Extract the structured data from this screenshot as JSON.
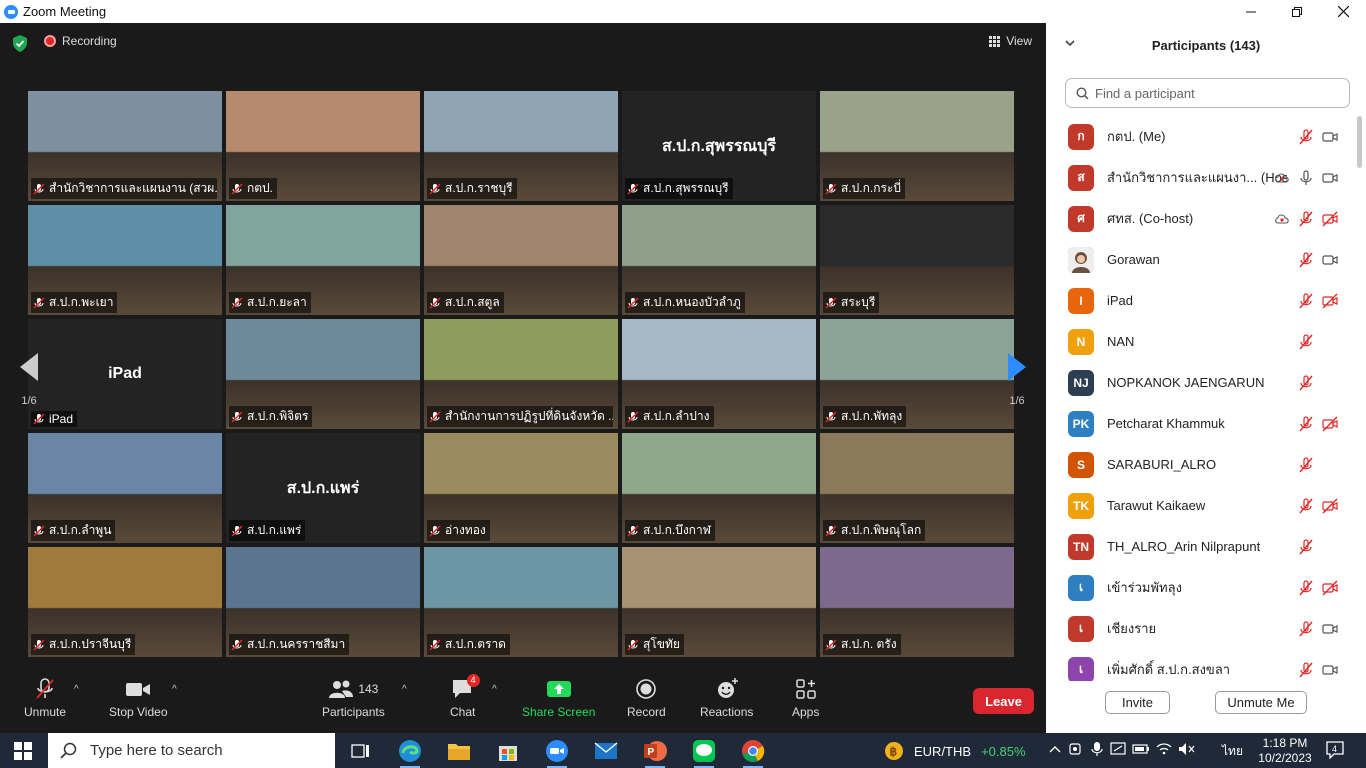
{
  "window": {
    "title": "Zoom Meeting",
    "controls": [
      "minimize-icon",
      "restore-icon",
      "close-icon"
    ]
  },
  "meeting_top": {
    "recording_label": "Recording",
    "view_label": "View"
  },
  "gallery": {
    "page_indicator": "1/6",
    "tiles": [
      {
        "name": "สำนักวิชาการและแผนงาน (สวผ.)",
        "kind": "video",
        "active": true,
        "bg": "#7d8fa0"
      },
      {
        "name": "กตป.",
        "kind": "video",
        "bg": "#b58a6f"
      },
      {
        "name": "ส.ป.ก.ราชบุรี",
        "kind": "video",
        "bg": "#8fa5b6"
      },
      {
        "name": "ส.ป.ก.สุพรรณบุรี",
        "kind": "name",
        "center": "ส.ป.ก.สุพรรณบุรี"
      },
      {
        "name": "ส.ป.ก.กระบี่",
        "kind": "video",
        "bg": "#9aa38a"
      },
      {
        "name": "ส.ป.ก.พะเยา",
        "kind": "video",
        "bg": "#5f8fa8"
      },
      {
        "name": "ส.ป.ก.ยะลา",
        "kind": "video",
        "bg": "#7fa59c"
      },
      {
        "name": "ส.ป.ก.สตูล",
        "kind": "video",
        "bg": "#a0846c"
      },
      {
        "name": "ส.ป.ก.หนองบัวลำภู",
        "kind": "video",
        "bg": "#8fa08a"
      },
      {
        "name": "สระบุรี",
        "kind": "video",
        "bg": "#2a2a2a"
      },
      {
        "name": "iPad",
        "kind": "name",
        "center": "iPad"
      },
      {
        "name": "ส.ป.ก.พิจิตร",
        "kind": "video",
        "bg": "#6d8a9a"
      },
      {
        "name": "สำนักงานการปฏิรูปที่ดินจังหวัด ...",
        "kind": "video",
        "bg": "#8f9d5c"
      },
      {
        "name": "ส.ป.ก.ลำปาง",
        "kind": "video",
        "bg": "#a7b7c4"
      },
      {
        "name": "ส.ป.ก.พัทลุง",
        "kind": "video",
        "bg": "#8ca398"
      },
      {
        "name": "ส.ป.ก.ลำพูน",
        "kind": "video",
        "bg": "#6a86a6"
      },
      {
        "name": "ส.ป.ก.แพร่",
        "kind": "name",
        "center": "ส.ป.ก.แพร่"
      },
      {
        "name": "อ่างทอง",
        "kind": "video",
        "bg": "#9b8a5e"
      },
      {
        "name": "ส.ป.ก.บึงกาฬ",
        "kind": "video",
        "bg": "#8fa88b"
      },
      {
        "name": "ส.ป.ก.พิษณุโลก",
        "kind": "video",
        "bg": "#8b7a5a"
      },
      {
        "name": "ส.ป.ก.ปราจีนบุรี",
        "kind": "video",
        "bg": "#a07a3c"
      },
      {
        "name": "ส.ป.ก.นครราชสีมา",
        "kind": "video",
        "bg": "#5b7591"
      },
      {
        "name": "ส.ป.ก.ตราด",
        "kind": "video",
        "bg": "#6d96a4"
      },
      {
        "name": "สุโขทัย",
        "kind": "video",
        "bg": "#a89274"
      },
      {
        "name": "ส.ป.ก. ตรัง",
        "kind": "video",
        "bg": "#7c6a8d"
      }
    ]
  },
  "toolbar": {
    "unmute": "Unmute",
    "stop_video": "Stop Video",
    "participants": "Participants",
    "participants_count": "143",
    "chat": "Chat",
    "chat_badge": "4",
    "share_screen": "Share Screen",
    "record": "Record",
    "reactions": "Reactions",
    "apps": "Apps",
    "leave": "Leave",
    "share_color": "#23d959"
  },
  "panel": {
    "title": "Participants (143)",
    "search_placeholder": "Find a participant",
    "invite": "Invite",
    "unmute_me": "Unmute Me",
    "participants": [
      {
        "initials": "ก",
        "name": "กตป. (Me)",
        "color": "#c0392b",
        "cloud": false,
        "mic": "off",
        "cam": "on"
      },
      {
        "initials": "ส",
        "name": "สำนักวิชาการและแผนงา... (Host)",
        "color": "#c0392b",
        "cloud": true,
        "mic": "on",
        "cam": "on"
      },
      {
        "initials": "ศ",
        "name": "ศทส. (Co-host)",
        "color": "#c0392b",
        "cloud": true,
        "mic": "off",
        "cam": "off"
      },
      {
        "initials": "",
        "name": "Gorawan",
        "color": "#6b4f3f",
        "photo": true,
        "cloud": false,
        "mic": "off",
        "cam": "on"
      },
      {
        "initials": "I",
        "name": "iPad",
        "color": "#e8650c",
        "cloud": false,
        "mic": "off",
        "cam": "off"
      },
      {
        "initials": "N",
        "name": "NAN",
        "color": "#f0a00c",
        "cloud": false,
        "mic": "off",
        "cam": "none"
      },
      {
        "initials": "NJ",
        "name": "NOPKANOK JAENGARUN",
        "color": "#2c3e50",
        "cloud": false,
        "mic": "off",
        "cam": "none"
      },
      {
        "initials": "PK",
        "name": "Petcharat Khammuk",
        "color": "#2d7fc1",
        "cloud": false,
        "mic": "off",
        "cam": "off"
      },
      {
        "initials": "S",
        "name": "SARABURI_ALRO",
        "color": "#d35400",
        "cloud": false,
        "mic": "off",
        "cam": "none"
      },
      {
        "initials": "TK",
        "name": "Tarawut Kaikaew",
        "color": "#f0a00c",
        "cloud": false,
        "mic": "off",
        "cam": "off"
      },
      {
        "initials": "TN",
        "name": "TH_ALRO_Arin Nilprapunt",
        "color": "#c0392b",
        "cloud": false,
        "mic": "off",
        "cam": "none"
      },
      {
        "initials": "เ",
        "name": "เข้าร่วมพัทลุง",
        "color": "#2d7fc1",
        "cloud": false,
        "mic": "off",
        "cam": "off"
      },
      {
        "initials": "เ",
        "name": "เชียงราย",
        "color": "#c0392b",
        "cloud": false,
        "mic": "off",
        "cam": "on"
      },
      {
        "initials": "เ",
        "name": "เพิ่มศักดิ์ ส.ป.ก.สงขลา",
        "color": "#8e44ad",
        "cloud": false,
        "mic": "off",
        "cam": "on"
      }
    ]
  },
  "taskbar": {
    "search_placeholder": "Type here to search",
    "ticker_symbol": "EUR/THB",
    "ticker_change": "+0.85%",
    "language": "ไทย",
    "time": "1:18 PM",
    "date": "10/2/2023",
    "notification_count": "4",
    "apps": [
      "task-view-icon",
      "edge-icon",
      "file-explorer-icon",
      "store-icon",
      "zoom-icon",
      "mail-icon",
      "powerpoint-icon",
      "line-icon",
      "chrome-icon"
    ]
  }
}
